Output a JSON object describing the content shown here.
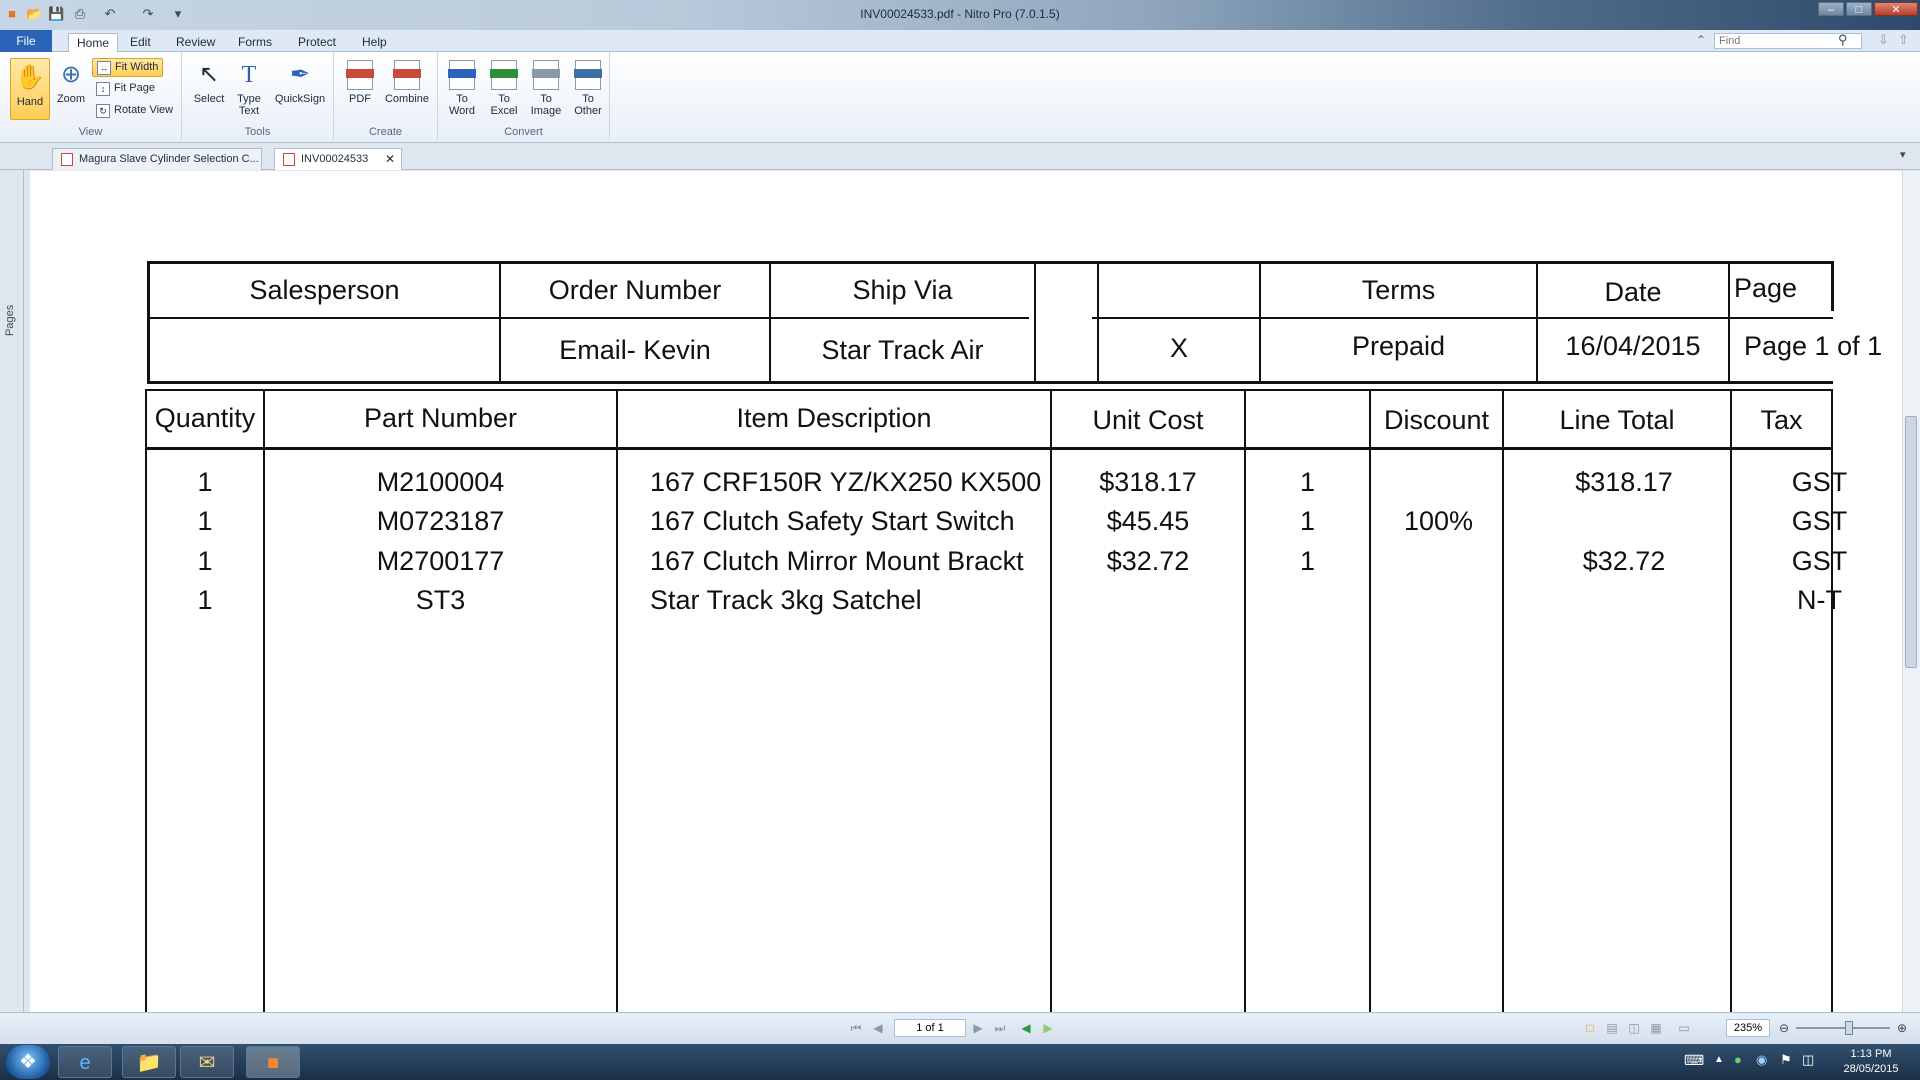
{
  "window": {
    "title": "INV00024533.pdf - Nitro Pro (7.0.1.5)"
  },
  "menu": {
    "file": "File",
    "tabs": [
      "Home",
      "Edit",
      "Review",
      "Forms",
      "Protect",
      "Help"
    ]
  },
  "find": {
    "placeholder": "Find"
  },
  "ribbon": {
    "view": {
      "label": "View",
      "hand": "Hand",
      "zoom": "Zoom",
      "fit_width": "Fit Width",
      "fit_page": "Fit Page",
      "rotate_view": "Rotate View"
    },
    "tools": {
      "label": "Tools",
      "select": "Select",
      "type_text_1": "Type",
      "type_text_2": "Text",
      "quicksign": "QuickSign"
    },
    "create": {
      "label": "Create",
      "pdf": "PDF",
      "combine": "Combine"
    },
    "convert": {
      "label": "Convert",
      "to": "To",
      "word": "Word",
      "excel": "Excel",
      "image": "Image",
      "other": "Other"
    }
  },
  "doc_tabs": [
    "Magura Slave Cylinder Selection C...",
    "INV00024533"
  ],
  "side_panel": {
    "pages": "Pages"
  },
  "invoice": {
    "header_labels": {
      "salesperson": "Salesperson",
      "order_number": "Order Number",
      "ship_via": "Ship Via",
      "terms": "Terms",
      "date": "Date",
      "page": "Page"
    },
    "header_values": {
      "salesperson": "",
      "order_number": "Email- Kevin",
      "ship_via": "Star Track Air",
      "x": "X",
      "terms": "Prepaid",
      "date": "16/04/2015",
      "page": "Page 1 of 1"
    },
    "columns": {
      "quantity": "Quantity",
      "part_number": "Part Number",
      "item_description": "Item Description",
      "unit_cost": "Unit Cost",
      "blank": "",
      "discount": "Discount",
      "line_total": "Line Total",
      "tax": "Tax"
    },
    "rows": [
      {
        "qty": "1",
        "part": "M2100004",
        "desc": "167 CRF150R YZ/KX250 KX500",
        "unit": "$318.17",
        "n": "1",
        "discount": "",
        "total": "$318.17",
        "tax": "GST"
      },
      {
        "qty": "1",
        "part": "M0723187",
        "desc": "167 Clutch Safety Start Switch",
        "unit": "$45.45",
        "n": "1",
        "discount": "100%",
        "total": "",
        "tax": "GST"
      },
      {
        "qty": "1",
        "part": "M2700177",
        "desc": "167 Clutch Mirror Mount Brackt",
        "unit": "$32.72",
        "n": "1",
        "discount": "",
        "total": "$32.72",
        "tax": "GST"
      },
      {
        "qty": "1",
        "part": "ST3",
        "desc": "Star Track 3kg Satchel",
        "unit": "",
        "n": "",
        "discount": "",
        "total": "",
        "tax": "N-T"
      }
    ]
  },
  "status": {
    "page_indicator": "1 of 1",
    "zoom": "235%"
  },
  "taskbar": {
    "time": "1:13 PM",
    "date": "28/05/2015"
  }
}
